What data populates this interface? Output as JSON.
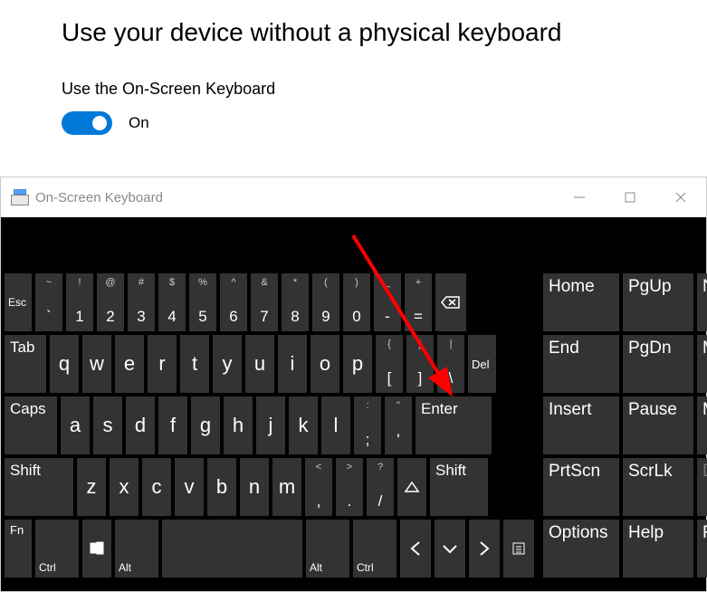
{
  "settings": {
    "heading": "Use your device without a physical keyboard",
    "sublabel": "Use the On-Screen Keyboard",
    "toggle_state": "On"
  },
  "osk": {
    "title": "On-Screen Keyboard",
    "row1": {
      "esc": "Esc",
      "nums": [
        {
          "u": "~",
          "d": "`"
        },
        {
          "u": "!",
          "d": "1"
        },
        {
          "u": "@",
          "d": "2"
        },
        {
          "u": "#",
          "d": "3"
        },
        {
          "u": "$",
          "d": "4"
        },
        {
          "u": "%",
          "d": "5"
        },
        {
          "u": "^",
          "d": "6"
        },
        {
          "u": "&",
          "d": "7"
        },
        {
          "u": "*",
          "d": "8"
        },
        {
          "u": "(",
          "d": "9"
        },
        {
          "u": ")",
          "d": "0"
        },
        {
          "u": "_",
          "d": "-"
        },
        {
          "u": "+",
          "d": "="
        }
      ]
    },
    "row2": {
      "tab": "Tab",
      "letters": [
        "q",
        "w",
        "e",
        "r",
        "t",
        "y",
        "u",
        "i",
        "o",
        "p"
      ],
      "brackets": [
        {
          "u": "{",
          "d": "["
        },
        {
          "u": "}",
          "d": "]"
        },
        {
          "u": "|",
          "d": "\\"
        }
      ],
      "del": "Del"
    },
    "row3": {
      "caps": "Caps",
      "letters": [
        "a",
        "s",
        "d",
        "f",
        "g",
        "h",
        "j",
        "k",
        "l"
      ],
      "punct": [
        {
          "u": ":",
          "d": ";"
        },
        {
          "u": "\"",
          "d": "'"
        }
      ],
      "enter": "Enter"
    },
    "row4": {
      "shiftL": "Shift",
      "letters": [
        "z",
        "x",
        "c",
        "v",
        "b",
        "n",
        "m"
      ],
      "punct": [
        {
          "u": "<",
          "d": ","
        },
        {
          "u": ">",
          "d": "."
        },
        {
          "u": "?",
          "d": "/"
        }
      ],
      "shiftR": "Shift"
    },
    "row5": {
      "fn": "Fn",
      "ctrl": "Ctrl",
      "alt": "Alt",
      "altR": "Alt",
      "ctrlR": "Ctrl"
    },
    "side": [
      [
        "Home",
        "PgUp",
        "Nav"
      ],
      [
        "End",
        "PgDn",
        "Mv Up"
      ],
      [
        "Insert",
        "Pause",
        "Mv Dn"
      ],
      [
        "PrtScn",
        "ScrLk",
        "Dock"
      ],
      [
        "Options",
        "Help",
        "Fade"
      ]
    ],
    "side_disabled": "Dock"
  }
}
